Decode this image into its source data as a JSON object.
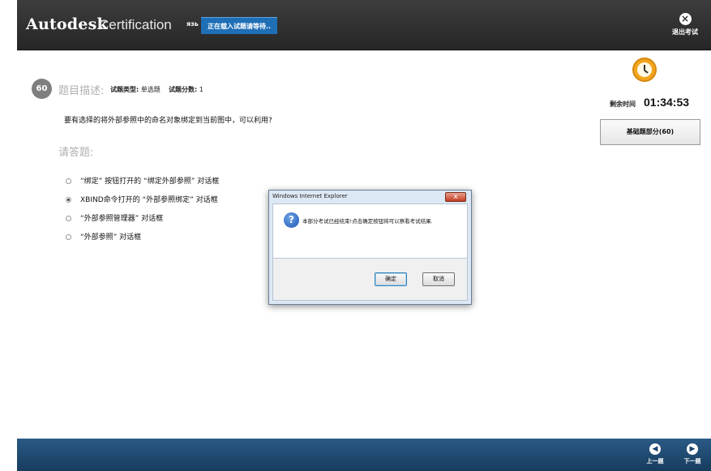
{
  "header": {
    "brand": "Autodesk",
    "product": "Certification",
    "language": "язь",
    "loading_status": "正在载入试题请等待..",
    "exit_label": "退出考试",
    "exit_icon": "close-circle-icon"
  },
  "question": {
    "number": "60",
    "description_label": "题目描述:",
    "type_label": "试题类型:",
    "type_value": "单选题",
    "score_label": "试题分数:",
    "score_value": "1",
    "text": "要有选择的将外部参照中的命名对象绑定到当前图中，可以利用?",
    "answer_label": "请答题:",
    "options": [
      {
        "label": "“绑定” 按钮打开的 “绑定外部参照” 对话框",
        "selected": false
      },
      {
        "label": "XBIND命令打开的 “外部参照绑定” 对话框",
        "selected": true
      },
      {
        "label": "“外部参照管理器” 对话框",
        "selected": false
      },
      {
        "label": "“外部参照” 对话框",
        "selected": false
      }
    ]
  },
  "timer": {
    "label": "剩余时间",
    "value": "01:34:53",
    "icon": "clock-icon"
  },
  "section_button": "基础题部分(60)",
  "footer": {
    "prev_label": "上一题",
    "next_label": "下一题",
    "prev_icon": "chevron-left-icon",
    "next_icon": "chevron-right-icon"
  },
  "dialog": {
    "title": "Windows Internet Explorer",
    "message": "本部分考试已经结束!点击确定按钮将可以察看考试结果.",
    "ok_label": "确定",
    "cancel_label": "取消",
    "close_glyph": "x",
    "icon": "question-icon"
  }
}
